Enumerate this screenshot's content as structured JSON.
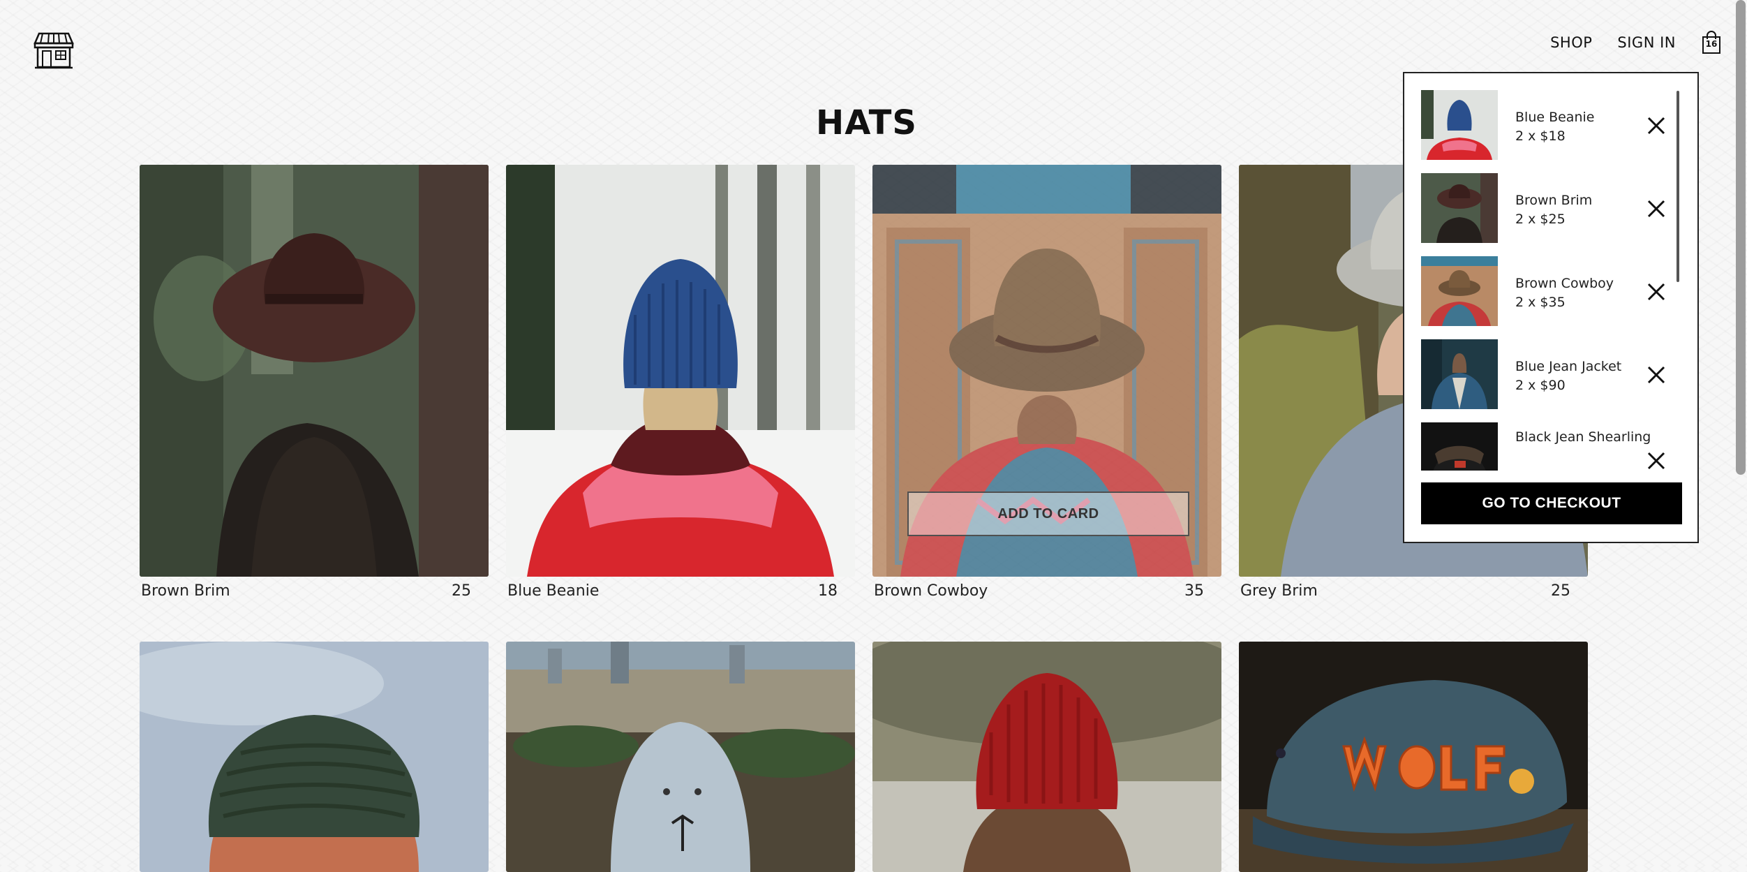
{
  "header": {
    "shop_label": "SHOP",
    "signin_label": "SIGN IN",
    "bag_count": "16"
  },
  "page_title": "HATS",
  "products": [
    {
      "name": "Brown Brim",
      "price": "25"
    },
    {
      "name": "Blue Beanie",
      "price": "18"
    },
    {
      "name": "Brown Cowboy",
      "price": "35"
    },
    {
      "name": "Grey Brim",
      "price": "25"
    }
  ],
  "add_to_cart_label": "ADD TO CARD",
  "cart": {
    "items": [
      {
        "name": "Blue Beanie",
        "qty_price": "2 x $18"
      },
      {
        "name": "Brown Brim",
        "qty_price": "2 x $25"
      },
      {
        "name": "Brown Cowboy",
        "qty_price": "2 x $35"
      },
      {
        "name": "Blue Jean Jacket",
        "qty_price": "2 x $90"
      },
      {
        "name": "Black Jean Shearling",
        "qty_price": ""
      }
    ],
    "checkout_label": "GO TO CHECKOUT"
  }
}
